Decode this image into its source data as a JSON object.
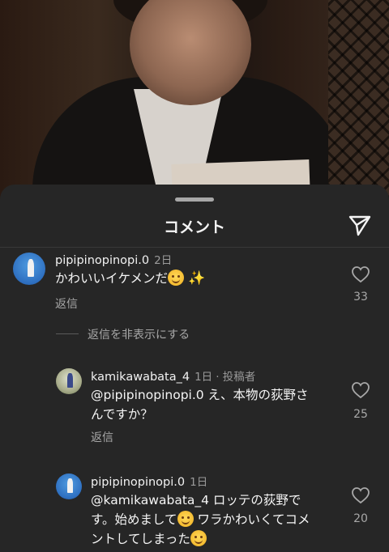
{
  "header": {
    "title": "コメント"
  },
  "comments": [
    {
      "username": "pipipinopinopi.0",
      "time": "2日",
      "text_before_emoji": "かわいいイケメンだ",
      "likes": "33",
      "reply_label": "返信"
    },
    {
      "username": "kamikawabata_4",
      "time": "1日",
      "badge": "· 投稿者",
      "text_line1": "@pipipinopinopi.0 え、本物の荻野さ",
      "text_line2": "んですか？",
      "likes": "25",
      "reply_label": "返信"
    },
    {
      "username": "pipipinopinopi.0",
      "time": "1日",
      "text_line1": "@kamikawabata_4 ロッテの荻野で",
      "text_line2_before": "す。始めまして",
      "text_line2_after": "ワラかわいくてコメ",
      "text_line3": "ントしてしまった",
      "likes": "20"
    }
  ],
  "hide_replies_label": "返信を非表示にする",
  "icons": {
    "share": "paper-plane-icon",
    "like": "heart-icon"
  },
  "colors": {
    "sheet_bg": "#262626",
    "secondary_text": "#a8a8a8",
    "primary_text": "#f5f5f5"
  }
}
